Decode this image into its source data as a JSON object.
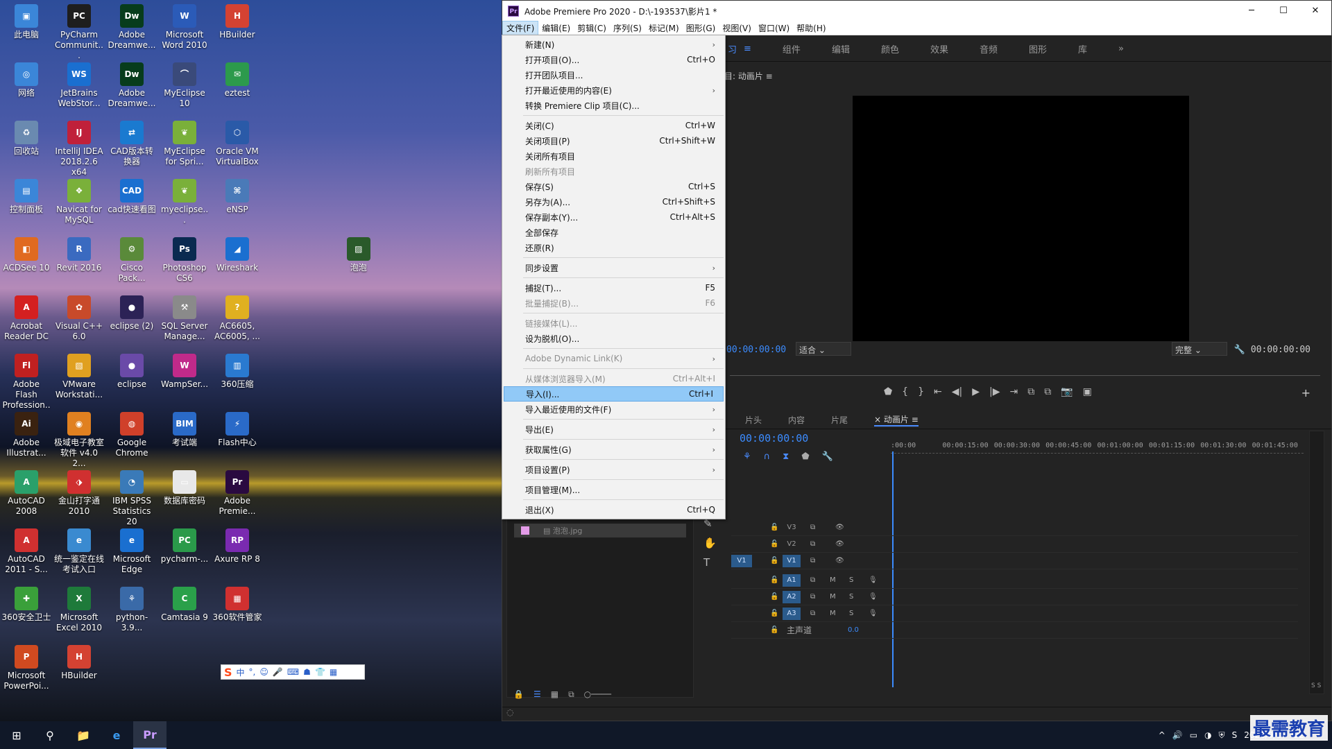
{
  "desktop": {
    "icons": [
      {
        "label": "此电脑",
        "glyph": "▣",
        "color": "#3b86d8"
      },
      {
        "label": "PyCharm Communit...",
        "glyph": "PC",
        "color": "#1e1e1e"
      },
      {
        "label": "Adobe Dreamwe...",
        "glyph": "Dw",
        "color": "#073c1c"
      },
      {
        "label": "Microsoft Word 2010",
        "glyph": "W",
        "color": "#2b5bb8"
      },
      {
        "label": "HBuilder",
        "glyph": "H",
        "color": "#d44232"
      },
      {
        "label": "网络",
        "glyph": "◎",
        "color": "#3b86d8"
      },
      {
        "label": "JetBrains WebStor...",
        "glyph": "WS",
        "color": "#1a6fd0"
      },
      {
        "label": "Adobe Dreamwe...",
        "glyph": "Dw",
        "color": "#073c1c"
      },
      {
        "label": "MyEclipse 10",
        "glyph": "⌒",
        "color": "#3a4a7a"
      },
      {
        "label": "eztest",
        "glyph": "✉",
        "color": "#2c9a4c"
      },
      {
        "label": "回收站",
        "glyph": "♻",
        "color": "#6a8ab0"
      },
      {
        "label": "IntelliJ IDEA 2018.2.6 x64",
        "glyph": "IJ",
        "color": "#c0203a"
      },
      {
        "label": "CAD版本转换器",
        "glyph": "⇄",
        "color": "#1a7ad0"
      },
      {
        "label": "MyEclipse for Spri...",
        "glyph": "❦",
        "color": "#7ab03a"
      },
      {
        "label": "Oracle VM VirtualBox",
        "glyph": "⬡",
        "color": "#2a5aa8"
      },
      {
        "label": "控制面板",
        "glyph": "▤",
        "color": "#3b86d8"
      },
      {
        "label": "Navicat for MySQL",
        "glyph": "❖",
        "color": "#7ab03a"
      },
      {
        "label": "cad快速看图",
        "glyph": "CAD",
        "color": "#1a6fd0"
      },
      {
        "label": "myeclipse...",
        "glyph": "❦",
        "color": "#7ab03a"
      },
      {
        "label": "eNSP",
        "glyph": "⌘",
        "color": "#4a7ab8"
      },
      {
        "label": "ACDSee 10",
        "glyph": "◧",
        "color": "#e06a20"
      },
      {
        "label": "Revit 2016",
        "glyph": "R",
        "color": "#3a6ac0"
      },
      {
        "label": "Cisco Pack...",
        "glyph": "⚙",
        "color": "#5a8a3a"
      },
      {
        "label": "Photoshop CS6",
        "glyph": "Ps",
        "color": "#0a2a50"
      },
      {
        "label": "Wireshark",
        "glyph": "◢",
        "color": "#1a6fd0"
      },
      {
        "label": "Acrobat Reader DC",
        "glyph": "A",
        "color": "#d42020"
      },
      {
        "label": "Visual C++ 6.0",
        "glyph": "✿",
        "color": "#c84a2a"
      },
      {
        "label": "eclipse (2)",
        "glyph": "●",
        "color": "#2c2256"
      },
      {
        "label": "SQL Server Manage...",
        "glyph": "⚒",
        "color": "#8a8a8a"
      },
      {
        "label": "AC6605, AC6005, ...",
        "glyph": "?",
        "color": "#e0b020"
      },
      {
        "label": "Adobe Flash Profession...",
        "glyph": "Fl",
        "color": "#c02020"
      },
      {
        "label": "VMware Workstati...",
        "glyph": "▧",
        "color": "#e0a020"
      },
      {
        "label": "eclipse",
        "glyph": "●",
        "color": "#6a4aa8"
      },
      {
        "label": "WampSer...",
        "glyph": "W",
        "color": "#c02a8a"
      },
      {
        "label": "360压缩",
        "glyph": "▥",
        "color": "#2a7ad0"
      },
      {
        "label": "Adobe Illustrat...",
        "glyph": "Ai",
        "color": "#3a2210"
      },
      {
        "label": "极域电子教室软件 v4.0 2...",
        "glyph": "◉",
        "color": "#e08020"
      },
      {
        "label": "Google Chrome",
        "glyph": "◍",
        "color": "#d0402a"
      },
      {
        "label": "考试端",
        "glyph": "BIM",
        "color": "#2a6ac8"
      },
      {
        "label": "Flash中心",
        "glyph": "⚡",
        "color": "#2a6ac8"
      },
      {
        "label": "AutoCAD 2008",
        "glyph": "A",
        "color": "#2aa06a"
      },
      {
        "label": "金山打字通 2010",
        "glyph": "⬗",
        "color": "#d03030"
      },
      {
        "label": "IBM SPSS Statistics 20",
        "glyph": "◔",
        "color": "#3a7ab8"
      },
      {
        "label": "数据库密码",
        "glyph": "▭",
        "color": "#e8e8e8"
      },
      {
        "label": "Adobe Premie...",
        "glyph": "Pr",
        "color": "#2a0a40"
      },
      {
        "label": "AutoCAD 2011 - S...",
        "glyph": "A",
        "color": "#d03030"
      },
      {
        "label": "统一鉴定在线考试入口",
        "glyph": "e",
        "color": "#3a8ad0"
      },
      {
        "label": "Microsoft Edge",
        "glyph": "e",
        "color": "#1a6fd0"
      },
      {
        "label": "pycharm-...",
        "glyph": "PC",
        "color": "#2a9a4a"
      },
      {
        "label": "Axure RP 8",
        "glyph": "RP",
        "color": "#7a2ab0"
      },
      {
        "label": "360安全卫士",
        "glyph": "✚",
        "color": "#3aa03a"
      },
      {
        "label": "Microsoft Excel 2010",
        "glyph": "X",
        "color": "#1e7a3a"
      },
      {
        "label": "python-3.9...",
        "glyph": "⚘",
        "color": "#3a6aa8"
      },
      {
        "label": "Camtasia 9",
        "glyph": "C",
        "color": "#2aa04a"
      },
      {
        "label": "360软件管家",
        "glyph": "▦",
        "color": "#d03030"
      },
      {
        "label": "Microsoft PowerPoi...",
        "glyph": "P",
        "color": "#d04a20"
      },
      {
        "label": "HBuilder",
        "glyph": "H",
        "color": "#d44232"
      },
      {
        "label": "泡泡",
        "glyph": "▨",
        "color": "#2a5a2a"
      }
    ]
  },
  "ime": {
    "items": [
      "S",
      "中",
      "°,",
      "☺",
      "🎤",
      "⌨",
      "☗",
      "👕",
      "▦"
    ]
  },
  "premiere": {
    "title": "Adobe Premiere Pro 2020 - D:\\-193537\\影片1 *",
    "logo": "Pr",
    "window_controls": [
      "─",
      "☐",
      "✕"
    ],
    "menu": [
      "文件(F)",
      "编辑(E)",
      "剪辑(C)",
      "序列(S)",
      "标记(M)",
      "图形(G)",
      "视图(V)",
      "窗口(W)",
      "帮助(H)"
    ],
    "workspaces": [
      "习",
      "≡",
      "组件",
      "编辑",
      "颜色",
      "效果",
      "音频",
      "图形",
      "库",
      "»"
    ],
    "program_label": "目: 动画片 ≡",
    "program_tc_left": "00:00:00:00",
    "program_fit": "适合",
    "program_full": "完整",
    "program_tc_right": "00:00:00:00",
    "transport": [
      "⬟",
      "{",
      "}",
      "⇤",
      "◀|",
      "▶",
      "|▶",
      "⇥",
      "⧉",
      "⧉",
      "📷",
      "▣"
    ],
    "timeline_tabs": [
      "片头",
      "内容",
      "片尾",
      "× 动画片 ≡"
    ],
    "timeline_tc": "00:00:00:00",
    "ruler": [
      ":00:00",
      "00:00:15:00",
      "00:00:30:00",
      "00:00:45:00",
      "00:01:00:00",
      "00:01:15:00",
      "00:01:30:00",
      "00:01:45:00"
    ],
    "tracks_video": [
      {
        "src": "",
        "name": "V3"
      },
      {
        "src": "",
        "name": "V2"
      },
      {
        "src": "V1",
        "name": "V1"
      }
    ],
    "tracks_audio": [
      {
        "name": "A1"
      },
      {
        "name": "A2"
      },
      {
        "name": "A3"
      }
    ],
    "master": {
      "label": "主声道",
      "value": "0.0"
    },
    "project_item": "泡泡.jpg",
    "meter_label": "S S"
  },
  "file_menu": {
    "items": [
      {
        "label": "新建(N)",
        "shortcut": "",
        "submenu": true,
        "disabled": false
      },
      {
        "label": "打开项目(O)...",
        "shortcut": "Ctrl+O",
        "submenu": false,
        "disabled": false
      },
      {
        "label": "打开团队项目...",
        "shortcut": "",
        "submenu": false,
        "disabled": false
      },
      {
        "label": "打开最近使用的内容(E)",
        "shortcut": "",
        "submenu": true,
        "disabled": false
      },
      {
        "label": "转换 Premiere Clip 项目(C)...",
        "shortcut": "",
        "submenu": false,
        "disabled": false
      },
      {
        "sep": true
      },
      {
        "label": "关闭(C)",
        "shortcut": "Ctrl+W",
        "submenu": false,
        "disabled": false
      },
      {
        "label": "关闭项目(P)",
        "shortcut": "Ctrl+Shift+W",
        "submenu": false,
        "disabled": false
      },
      {
        "label": "关闭所有项目",
        "shortcut": "",
        "submenu": false,
        "disabled": false
      },
      {
        "label": "刷新所有项目",
        "shortcut": "",
        "submenu": false,
        "disabled": true
      },
      {
        "label": "保存(S)",
        "shortcut": "Ctrl+S",
        "submenu": false,
        "disabled": false
      },
      {
        "label": "另存为(A)...",
        "shortcut": "Ctrl+Shift+S",
        "submenu": false,
        "disabled": false
      },
      {
        "label": "保存副本(Y)...",
        "shortcut": "Ctrl+Alt+S",
        "submenu": false,
        "disabled": false
      },
      {
        "label": "全部保存",
        "shortcut": "",
        "submenu": false,
        "disabled": false
      },
      {
        "label": "还原(R)",
        "shortcut": "",
        "submenu": false,
        "disabled": false
      },
      {
        "sep": true
      },
      {
        "label": "同步设置",
        "shortcut": "",
        "submenu": true,
        "disabled": false
      },
      {
        "sep": true
      },
      {
        "label": "捕捉(T)...",
        "shortcut": "F5",
        "submenu": false,
        "disabled": false
      },
      {
        "label": "批量捕捉(B)...",
        "shortcut": "F6",
        "submenu": false,
        "disabled": true
      },
      {
        "sep": true
      },
      {
        "label": "链接媒体(L)...",
        "shortcut": "",
        "submenu": false,
        "disabled": true
      },
      {
        "label": "设为脱机(O)...",
        "shortcut": "",
        "submenu": false,
        "disabled": false
      },
      {
        "sep": true
      },
      {
        "label": "Adobe Dynamic Link(K)",
        "shortcut": "",
        "submenu": true,
        "disabled": true
      },
      {
        "sep": true
      },
      {
        "label": "从媒体浏览器导入(M)",
        "shortcut": "Ctrl+Alt+I",
        "submenu": false,
        "disabled": true
      },
      {
        "label": "导入(I)...",
        "shortcut": "Ctrl+I",
        "submenu": false,
        "disabled": false,
        "highlight": true
      },
      {
        "label": "导入最近使用的文件(F)",
        "shortcut": "",
        "submenu": true,
        "disabled": false
      },
      {
        "sep": true
      },
      {
        "label": "导出(E)",
        "shortcut": "",
        "submenu": true,
        "disabled": false
      },
      {
        "sep": true
      },
      {
        "label": "获取属性(G)",
        "shortcut": "",
        "submenu": true,
        "disabled": false
      },
      {
        "sep": true
      },
      {
        "label": "项目设置(P)",
        "shortcut": "",
        "submenu": true,
        "disabled": false
      },
      {
        "sep": true
      },
      {
        "label": "项目管理(M)...",
        "shortcut": "",
        "submenu": false,
        "disabled": false
      },
      {
        "sep": true
      },
      {
        "label": "退出(X)",
        "shortcut": "Ctrl+Q",
        "submenu": false,
        "disabled": false
      }
    ]
  },
  "taskbar": {
    "start_glyph": "⊞",
    "search_glyph": "⚲",
    "apps": [
      "📁",
      "e",
      "Pr"
    ],
    "tray": [
      "^",
      "🔊",
      "▭",
      "◑",
      "⛨",
      "S"
    ],
    "time": "",
    "date": "2021/9/17",
    "notify": "22"
  },
  "watermark": "最需教育"
}
